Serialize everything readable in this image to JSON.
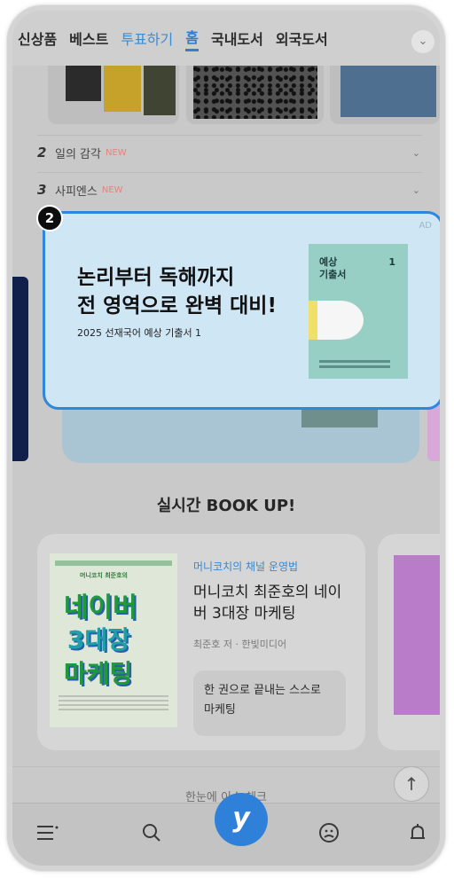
{
  "top_tabs": {
    "items": [
      "신상품",
      "베스트",
      "투표하기",
      "홈",
      "국내도서",
      "외국도서"
    ],
    "more": "⌄"
  },
  "list": [
    {
      "rank": "2",
      "title": "일의 감각",
      "badge": "NEW"
    },
    {
      "rank": "3",
      "title": "사피엔스",
      "badge": "NEW"
    }
  ],
  "popup": {
    "step": "2",
    "ad_label": "AD",
    "headline": "논리부터 독해까지\n전 영역으로 완벽 대비!",
    "subline": "2025 선재국어 예상 기출서 1",
    "cover_title": "예상\n기출서",
    "cover_number": "1"
  },
  "section": {
    "title": "실시간 BOOK UP!"
  },
  "book_card": {
    "cover_words": [
      "네이버",
      "3대장",
      "마케팅"
    ],
    "cover_subtitle": "머니코치 최준호의",
    "tag": "머니코치의 채널 운영법",
    "title": "머니코치 최준호의 네이버 3대장 마케팅",
    "author": "최준호 저 · 한빛미디어",
    "quote": "한 권으로 끝내는 스스로 마케팅"
  },
  "peek_text": "한눈에 이슈 체크",
  "bottom_nav": {
    "home_label": "y"
  },
  "colors": {
    "accent": "#2f80d8",
    "popup_bg": "#cfe6f5",
    "new_badge": "#e3837d"
  },
  "icons": [
    "chevron-down-icon",
    "arrow-up-icon",
    "menu-icon",
    "search-icon",
    "home-logo-icon",
    "profile-icon",
    "bell-icon"
  ]
}
